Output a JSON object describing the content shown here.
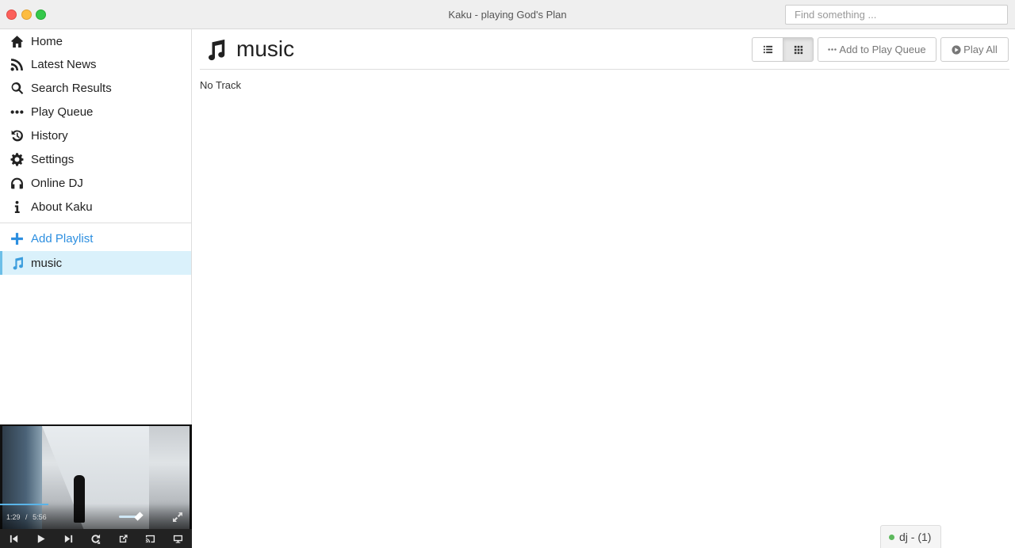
{
  "window": {
    "title": "Kaku - playing God's Plan"
  },
  "search": {
    "placeholder": "Find something ..."
  },
  "sidebar": {
    "items": [
      {
        "label": "Home",
        "icon": "home-icon"
      },
      {
        "label": "Latest News",
        "icon": "rss-icon"
      },
      {
        "label": "Search Results",
        "icon": "search-icon"
      },
      {
        "label": "Play Queue",
        "icon": "ellipsis-icon"
      },
      {
        "label": "History",
        "icon": "history-icon"
      },
      {
        "label": "Settings",
        "icon": "gear-icon"
      },
      {
        "label": "Online DJ",
        "icon": "headphones-icon"
      },
      {
        "label": "About Kaku",
        "icon": "info-icon"
      }
    ],
    "add_playlist": {
      "label": "Add Playlist",
      "icon": "plus-icon",
      "color": "#2d8fe0"
    },
    "playlists": [
      {
        "label": "music",
        "icon": "music-icon",
        "active": true
      }
    ]
  },
  "player": {
    "current_time": "1:29",
    "separator": "/",
    "duration": "5:56",
    "progress_fraction": 0.25,
    "controls": [
      "previous-icon",
      "play-icon",
      "next-icon",
      "repeat-icon",
      "external-icon",
      "cast-icon",
      "display-icon"
    ]
  },
  "main": {
    "title": "music",
    "title_icon": "music-icon",
    "buttons": {
      "add_to_queue": "Add to Play Queue",
      "play_all": "Play All"
    },
    "empty_text": "No Track"
  },
  "dj": {
    "label": "dj - (1)",
    "status_color": "#5cb85c"
  }
}
